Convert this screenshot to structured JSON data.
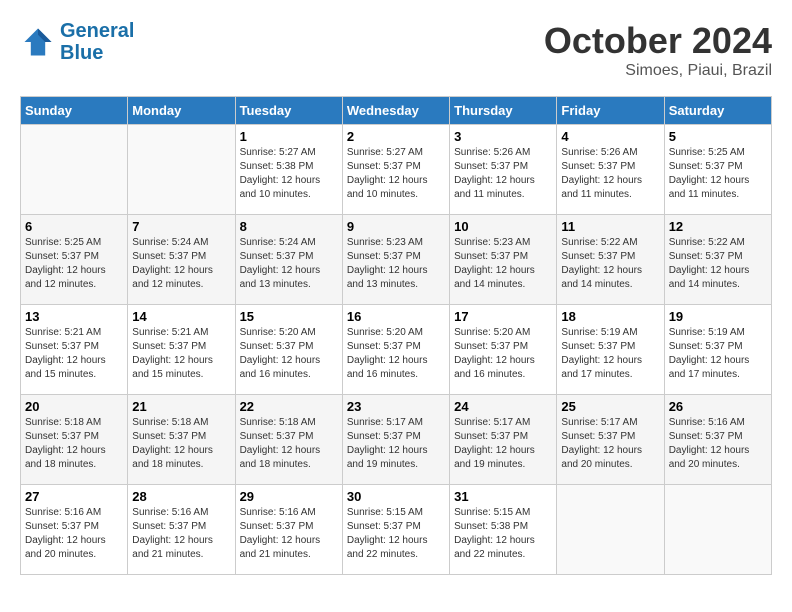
{
  "header": {
    "logo_line1": "General",
    "logo_line2": "Blue",
    "month": "October 2024",
    "location": "Simoes, Piaui, Brazil"
  },
  "weekdays": [
    "Sunday",
    "Monday",
    "Tuesday",
    "Wednesday",
    "Thursday",
    "Friday",
    "Saturday"
  ],
  "weeks": [
    [
      {
        "day": "",
        "sunrise": "",
        "sunset": "",
        "daylight": ""
      },
      {
        "day": "",
        "sunrise": "",
        "sunset": "",
        "daylight": ""
      },
      {
        "day": "1",
        "sunrise": "Sunrise: 5:27 AM",
        "sunset": "Sunset: 5:38 PM",
        "daylight": "Daylight: 12 hours and 10 minutes."
      },
      {
        "day": "2",
        "sunrise": "Sunrise: 5:27 AM",
        "sunset": "Sunset: 5:37 PM",
        "daylight": "Daylight: 12 hours and 10 minutes."
      },
      {
        "day": "3",
        "sunrise": "Sunrise: 5:26 AM",
        "sunset": "Sunset: 5:37 PM",
        "daylight": "Daylight: 12 hours and 11 minutes."
      },
      {
        "day": "4",
        "sunrise": "Sunrise: 5:26 AM",
        "sunset": "Sunset: 5:37 PM",
        "daylight": "Daylight: 12 hours and 11 minutes."
      },
      {
        "day": "5",
        "sunrise": "Sunrise: 5:25 AM",
        "sunset": "Sunset: 5:37 PM",
        "daylight": "Daylight: 12 hours and 11 minutes."
      }
    ],
    [
      {
        "day": "6",
        "sunrise": "Sunrise: 5:25 AM",
        "sunset": "Sunset: 5:37 PM",
        "daylight": "Daylight: 12 hours and 12 minutes."
      },
      {
        "day": "7",
        "sunrise": "Sunrise: 5:24 AM",
        "sunset": "Sunset: 5:37 PM",
        "daylight": "Daylight: 12 hours and 12 minutes."
      },
      {
        "day": "8",
        "sunrise": "Sunrise: 5:24 AM",
        "sunset": "Sunset: 5:37 PM",
        "daylight": "Daylight: 12 hours and 13 minutes."
      },
      {
        "day": "9",
        "sunrise": "Sunrise: 5:23 AM",
        "sunset": "Sunset: 5:37 PM",
        "daylight": "Daylight: 12 hours and 13 minutes."
      },
      {
        "day": "10",
        "sunrise": "Sunrise: 5:23 AM",
        "sunset": "Sunset: 5:37 PM",
        "daylight": "Daylight: 12 hours and 14 minutes."
      },
      {
        "day": "11",
        "sunrise": "Sunrise: 5:22 AM",
        "sunset": "Sunset: 5:37 PM",
        "daylight": "Daylight: 12 hours and 14 minutes."
      },
      {
        "day": "12",
        "sunrise": "Sunrise: 5:22 AM",
        "sunset": "Sunset: 5:37 PM",
        "daylight": "Daylight: 12 hours and 14 minutes."
      }
    ],
    [
      {
        "day": "13",
        "sunrise": "Sunrise: 5:21 AM",
        "sunset": "Sunset: 5:37 PM",
        "daylight": "Daylight: 12 hours and 15 minutes."
      },
      {
        "day": "14",
        "sunrise": "Sunrise: 5:21 AM",
        "sunset": "Sunset: 5:37 PM",
        "daylight": "Daylight: 12 hours and 15 minutes."
      },
      {
        "day": "15",
        "sunrise": "Sunrise: 5:20 AM",
        "sunset": "Sunset: 5:37 PM",
        "daylight": "Daylight: 12 hours and 16 minutes."
      },
      {
        "day": "16",
        "sunrise": "Sunrise: 5:20 AM",
        "sunset": "Sunset: 5:37 PM",
        "daylight": "Daylight: 12 hours and 16 minutes."
      },
      {
        "day": "17",
        "sunrise": "Sunrise: 5:20 AM",
        "sunset": "Sunset: 5:37 PM",
        "daylight": "Daylight: 12 hours and 16 minutes."
      },
      {
        "day": "18",
        "sunrise": "Sunrise: 5:19 AM",
        "sunset": "Sunset: 5:37 PM",
        "daylight": "Daylight: 12 hours and 17 minutes."
      },
      {
        "day": "19",
        "sunrise": "Sunrise: 5:19 AM",
        "sunset": "Sunset: 5:37 PM",
        "daylight": "Daylight: 12 hours and 17 minutes."
      }
    ],
    [
      {
        "day": "20",
        "sunrise": "Sunrise: 5:18 AM",
        "sunset": "Sunset: 5:37 PM",
        "daylight": "Daylight: 12 hours and 18 minutes."
      },
      {
        "day": "21",
        "sunrise": "Sunrise: 5:18 AM",
        "sunset": "Sunset: 5:37 PM",
        "daylight": "Daylight: 12 hours and 18 minutes."
      },
      {
        "day": "22",
        "sunrise": "Sunrise: 5:18 AM",
        "sunset": "Sunset: 5:37 PM",
        "daylight": "Daylight: 12 hours and 18 minutes."
      },
      {
        "day": "23",
        "sunrise": "Sunrise: 5:17 AM",
        "sunset": "Sunset: 5:37 PM",
        "daylight": "Daylight: 12 hours and 19 minutes."
      },
      {
        "day": "24",
        "sunrise": "Sunrise: 5:17 AM",
        "sunset": "Sunset: 5:37 PM",
        "daylight": "Daylight: 12 hours and 19 minutes."
      },
      {
        "day": "25",
        "sunrise": "Sunrise: 5:17 AM",
        "sunset": "Sunset: 5:37 PM",
        "daylight": "Daylight: 12 hours and 20 minutes."
      },
      {
        "day": "26",
        "sunrise": "Sunrise: 5:16 AM",
        "sunset": "Sunset: 5:37 PM",
        "daylight": "Daylight: 12 hours and 20 minutes."
      }
    ],
    [
      {
        "day": "27",
        "sunrise": "Sunrise: 5:16 AM",
        "sunset": "Sunset: 5:37 PM",
        "daylight": "Daylight: 12 hours and 20 minutes."
      },
      {
        "day": "28",
        "sunrise": "Sunrise: 5:16 AM",
        "sunset": "Sunset: 5:37 PM",
        "daylight": "Daylight: 12 hours and 21 minutes."
      },
      {
        "day": "29",
        "sunrise": "Sunrise: 5:16 AM",
        "sunset": "Sunset: 5:37 PM",
        "daylight": "Daylight: 12 hours and 21 minutes."
      },
      {
        "day": "30",
        "sunrise": "Sunrise: 5:15 AM",
        "sunset": "Sunset: 5:37 PM",
        "daylight": "Daylight: 12 hours and 22 minutes."
      },
      {
        "day": "31",
        "sunrise": "Sunrise: 5:15 AM",
        "sunset": "Sunset: 5:38 PM",
        "daylight": "Daylight: 12 hours and 22 minutes."
      },
      {
        "day": "",
        "sunrise": "",
        "sunset": "",
        "daylight": ""
      },
      {
        "day": "",
        "sunrise": "",
        "sunset": "",
        "daylight": ""
      }
    ]
  ]
}
